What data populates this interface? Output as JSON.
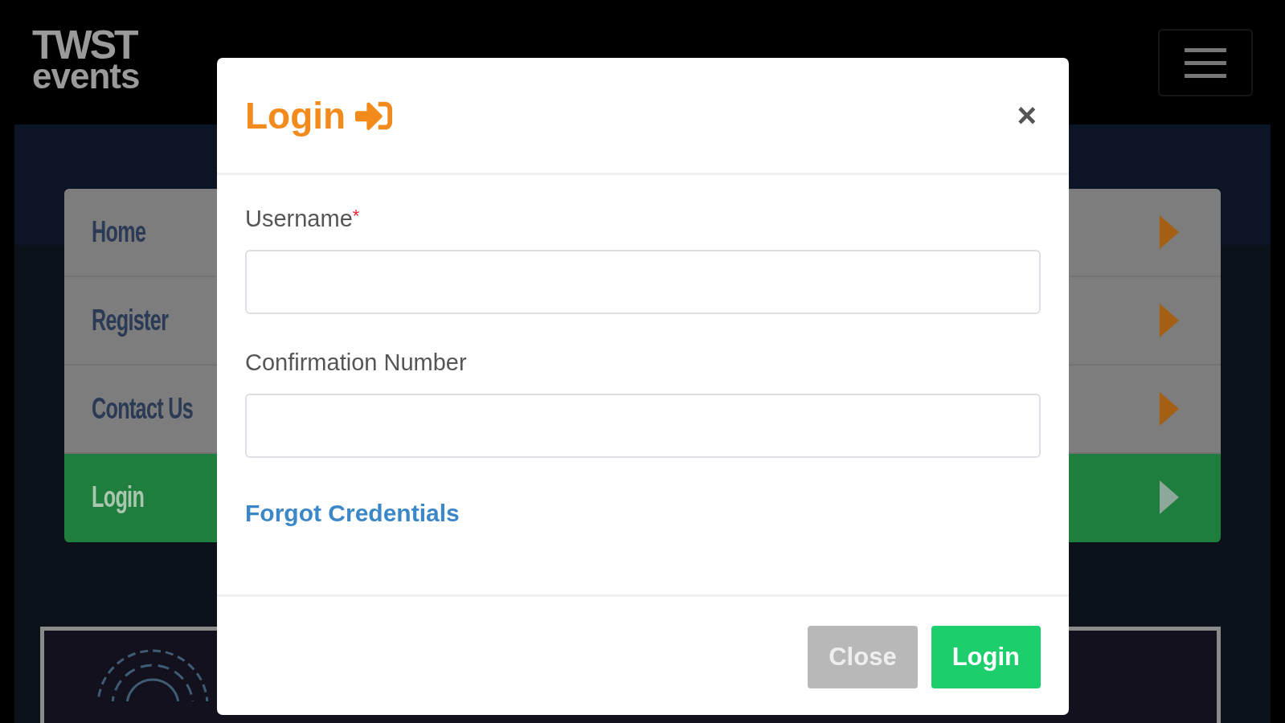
{
  "header": {
    "logo": {
      "line1": "TWST",
      "line2": "events"
    }
  },
  "nav": {
    "items": [
      {
        "label": "Home",
        "selected": false
      },
      {
        "label": "Register",
        "selected": false
      },
      {
        "label": "Contact Us",
        "selected": false
      },
      {
        "label": "Login",
        "selected": true
      }
    ]
  },
  "modal": {
    "title": "Login",
    "close": "×",
    "fields": [
      {
        "label": "Username",
        "required_mark": "*"
      },
      {
        "label": "Confirmation Number"
      }
    ],
    "link": "Forgot Credentials",
    "buttons": [
      {
        "label": "Close",
        "kind": "secondary"
      },
      {
        "label": "Login",
        "kind": "primary"
      }
    ]
  }
}
